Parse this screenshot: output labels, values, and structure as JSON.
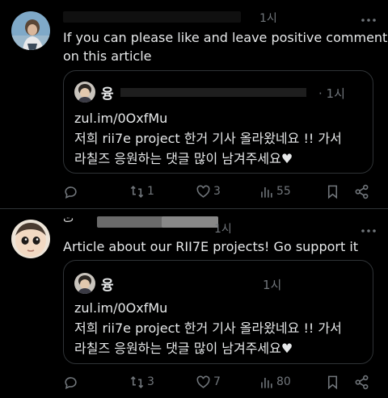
{
  "posts": [
    {
      "time": "1시",
      "text_lines": [
        "If you can please like and leave positive comments",
        "on this article"
      ],
      "quote": {
        "name": "융",
        "time": "· 1시",
        "lines": [
          "zul.im/0OxfMu",
          "저희 rii7e project 한거 기사 올라왔네요 !! 가서",
          "라칠즈 응원하는 댓글 많이 남겨주세요♥"
        ]
      },
      "actions": {
        "reply": "",
        "repost": "1",
        "like": "3",
        "views": "55"
      }
    },
    {
      "name_prefix": "ت",
      "time": "1시",
      "text_lines": [
        "Article about our RII7E projects! Go support it"
      ],
      "quote": {
        "name": "융",
        "time": "1시",
        "lines": [
          "zul.im/0OxfMu",
          "저희 rii7e project 한거 기사 올라왔네요 !! 가서",
          "라칠즈 응원하는 댓글 많이 남겨주세요♥"
        ]
      },
      "actions": {
        "reply": "",
        "repost": "3",
        "like": "7",
        "views": "80"
      }
    }
  ],
  "colors": {
    "background": "#000000",
    "text": "#e7e9ea",
    "muted": "#71767b",
    "border": "#2f3336"
  },
  "icons": [
    "more-icon",
    "reply-icon",
    "repost-icon",
    "like-icon",
    "views-icon",
    "bookmark-icon",
    "share-icon"
  ]
}
